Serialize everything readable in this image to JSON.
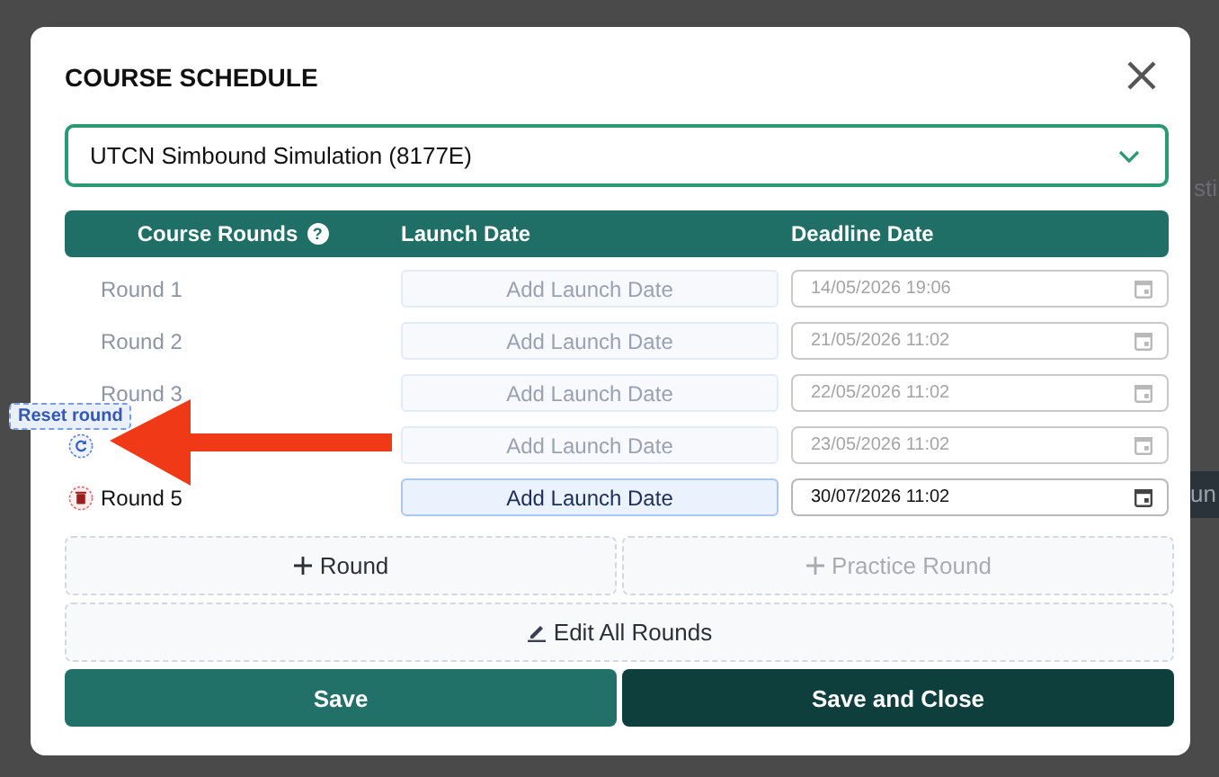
{
  "title": "COURSE SCHEDULE",
  "course_select": {
    "value": "UTCN Simbound Simulation (8177E)"
  },
  "table": {
    "columns": [
      {
        "label": "Course Rounds",
        "help": "?"
      },
      {
        "label": "Launch Date"
      },
      {
        "label": "Deadline Date"
      }
    ],
    "rows": [
      {
        "name": "Round 1",
        "launch": "Add Launch Date",
        "deadline": "14/05/2026 19:06",
        "disabled": true
      },
      {
        "name": "Round 2",
        "launch": "Add Launch Date",
        "deadline": "21/05/2026 11:02",
        "disabled": true
      },
      {
        "name": "Round 3",
        "launch": "Add Launch Date",
        "deadline": "22/05/2026 11:02",
        "disabled": true
      },
      {
        "launch": "Add Launch Date",
        "deadline": "23/05/2026 11:02",
        "disabled": true,
        "kind": "reset"
      },
      {
        "name": "Round 5",
        "launch": "Add Launch Date",
        "deadline": "30/07/2026 11:02",
        "disabled": false,
        "kind": "delete"
      }
    ]
  },
  "tooltip": "Reset round",
  "buttons": [
    {
      "label": "Round",
      "kind": "add",
      "disabled": false
    },
    {
      "label": "Practice Round",
      "kind": "add",
      "disabled": true
    },
    {
      "label": "Edit All Rounds",
      "kind": "edit",
      "disabled": false
    }
  ],
  "footer": [
    {
      "label": "Save",
      "kind": "primary"
    },
    {
      "label": "Save and Close",
      "kind": "dark"
    }
  ],
  "background_texts": [
    "sti",
    "un"
  ]
}
